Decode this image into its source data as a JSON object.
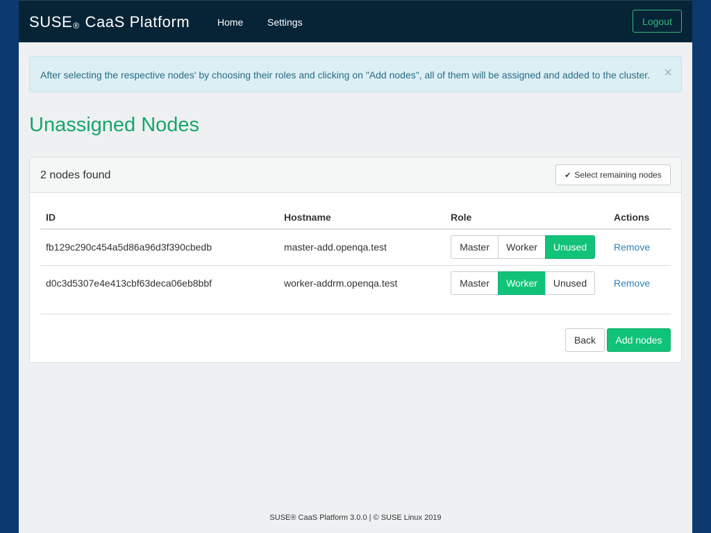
{
  "navbar": {
    "brand_left": "SUSE",
    "brand_reg": "®",
    "brand_right": "CaaS Platform",
    "links": [
      "Home",
      "Settings"
    ],
    "logout_label": "Logout"
  },
  "alert": {
    "text": "After selecting the respective nodes' by choosing their roles and clicking on \"Add nodes\", all of them will be assigned and added to the cluster.",
    "close_glyph": "×"
  },
  "page_title": "Unassigned Nodes",
  "panel": {
    "found_text": "2 nodes found",
    "select_remaining_label": "Select remaining nodes",
    "columns": [
      "ID",
      "Hostname",
      "Role",
      "Actions"
    ],
    "role_options": [
      "Master",
      "Worker",
      "Unused"
    ],
    "nodes": [
      {
        "id": "fb129c290c454a5d86a96d3f390cbedb",
        "hostname": "master-add.openqa.test",
        "selected_role": "Unused",
        "action": "Remove"
      },
      {
        "id": "d0c3d5307e4e413cbf63deca06eb8bbf",
        "hostname": "worker-addrm.openqa.test",
        "selected_role": "Worker",
        "action": "Remove"
      }
    ],
    "back_label": "Back",
    "add_label": "Add nodes"
  },
  "footer": "SUSE® CaaS Platform 3.0.0 | © SUSE Linux 2019",
  "colors": {
    "navbar_bg": "#072437",
    "accent_green": "#30ba78",
    "active_role": "#10c378",
    "title_green": "#16a56d",
    "link_blue": "#2f80b8"
  }
}
